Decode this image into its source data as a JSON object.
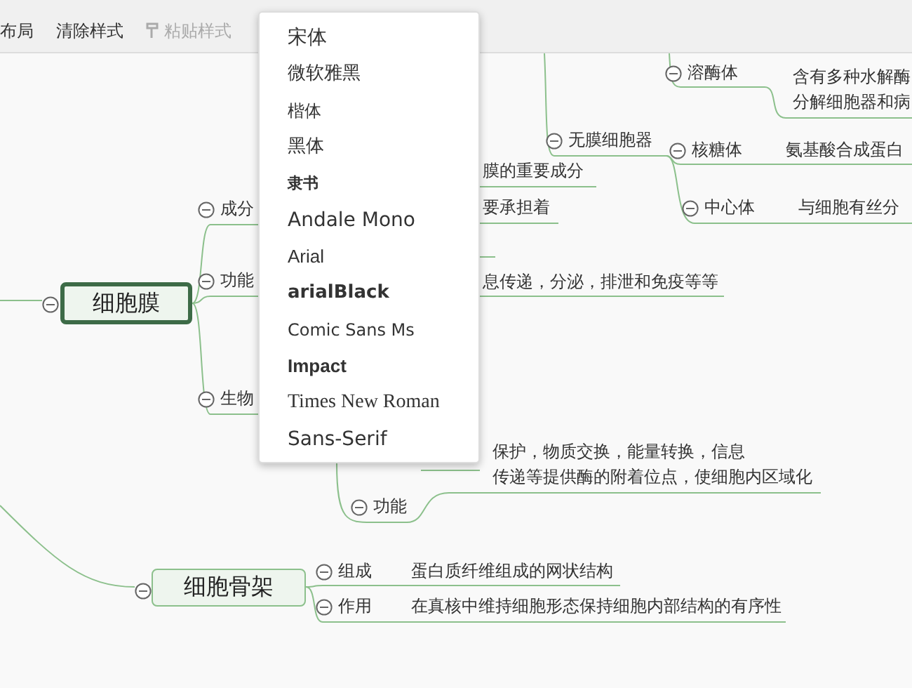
{
  "toolbar": [
    {
      "label": "布局",
      "disabled": false
    },
    {
      "label": "清除样式",
      "disabled": false
    },
    {
      "label": "粘贴样式",
      "disabled": true
    }
  ],
  "mind_map": {
    "central_topics": [
      {
        "label": "细胞膜",
        "selected": true
      },
      {
        "label": "细胞骨架",
        "selected": false
      }
    ],
    "branches": [
      "成分",
      "功能",
      "生物",
      "无膜细胞器",
      "溶酶体",
      "核糖体",
      "中心体",
      "功能",
      "组成",
      "作用"
    ],
    "notes": [
      "膜的重要成分",
      "要承担着",
      "息传递，分泌，排泄和免疫等等",
      "含有多种水解酶",
      "分解细胞器和病",
      "氨基酸合成蛋白",
      "与细胞有丝分",
      "保护，物质交换，能量转换，信息",
      "传递等提供酶的附着位点，使细胞内区域化",
      "蛋白质纤维组成的网状结构",
      "在真核中维持细胞形态保持细胞内部结构的有序性"
    ]
  },
  "font_menu": [
    "宋体",
    "微软雅黑",
    "楷体",
    "黑体",
    "隶书",
    "Andale Mono",
    "Arial",
    "arialBlack",
    "Comic Sans Ms",
    "Impact",
    "Times New Roman",
    "Sans-Serif"
  ]
}
